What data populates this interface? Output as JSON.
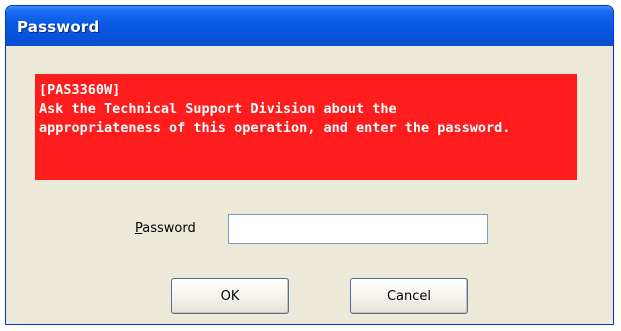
{
  "window": {
    "title": "Password"
  },
  "warning": {
    "lines": [
      "[PAS3360W]",
      "Ask the Technical Support Division about the",
      "appropriateness of this operation, and enter the password."
    ]
  },
  "password": {
    "label_accel": "P",
    "label_rest": "assword",
    "value": ""
  },
  "buttons": {
    "ok_label": "OK",
    "cancel_label": "Cancel"
  },
  "colors": {
    "titlebar": "#0a5ce6",
    "warning_background": "#ff1c1c",
    "dialog_background": "#ece9d8"
  }
}
